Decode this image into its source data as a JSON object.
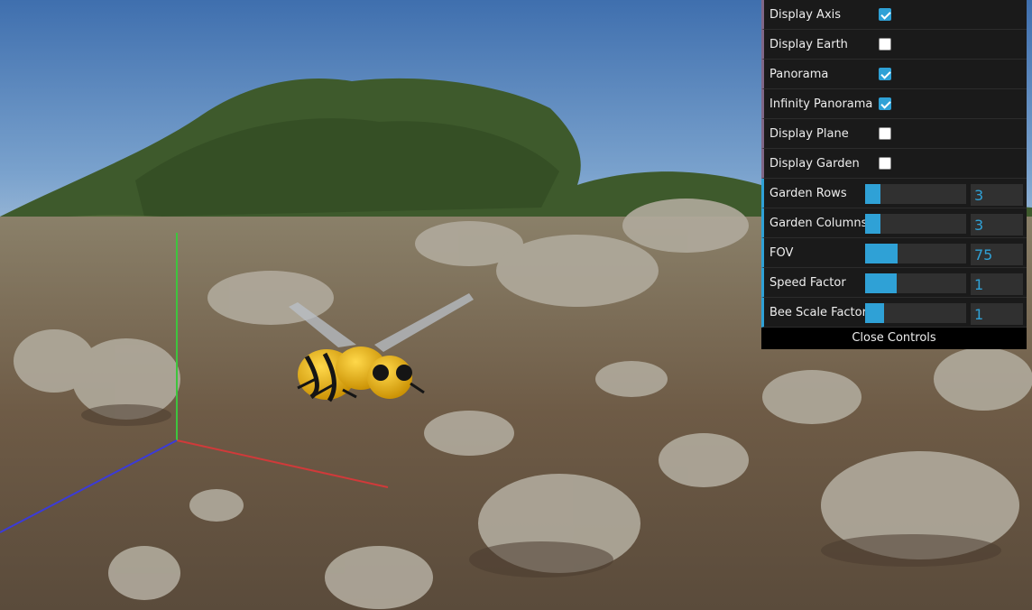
{
  "controls": {
    "toggles": [
      {
        "label": "Display Axis",
        "checked": true
      },
      {
        "label": "Display Earth",
        "checked": false
      },
      {
        "label": "Panorama",
        "checked": true
      },
      {
        "label": "Infinity Panorama",
        "checked": true
      },
      {
        "label": "Display Plane",
        "checked": false
      },
      {
        "label": "Display Garden",
        "checked": false
      }
    ],
    "sliders": [
      {
        "label": "Garden Rows",
        "value": "3",
        "fill": 0.15
      },
      {
        "label": "Garden Columns",
        "value": "3",
        "fill": 0.15
      },
      {
        "label": "FOV",
        "value": "75",
        "fill": 0.32
      },
      {
        "label": "Speed Factor",
        "value": "1",
        "fill": 0.31
      },
      {
        "label": "Bee Scale Factor",
        "value": "1",
        "fill": 0.19
      }
    ],
    "close_label": "Close Controls"
  },
  "scene": {
    "axis_colors": {
      "x": "#d03a3a",
      "y": "#3ec43e",
      "z": "#3b3bd8"
    },
    "bee_colors": {
      "body": "#f2b705",
      "stripe": "#151515",
      "wing": "#b9c0c8"
    },
    "sky_color": "#4f7cb6"
  }
}
